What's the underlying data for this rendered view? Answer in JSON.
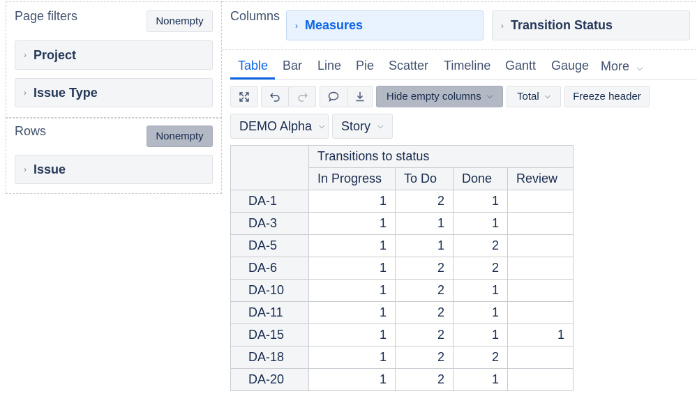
{
  "left_panel": {
    "page_filters": {
      "title": "Page filters",
      "nonempty_label": "Nonempty",
      "items": [
        {
          "label": "Project"
        },
        {
          "label": "Issue Type"
        }
      ]
    },
    "rows": {
      "title": "Rows",
      "nonempty_label": "Nonempty",
      "items": [
        {
          "label": "Issue"
        }
      ]
    }
  },
  "columns_panel": {
    "title": "Columns",
    "items": [
      {
        "label": "Measures"
      },
      {
        "label": "Transition Status"
      }
    ]
  },
  "view_tabs": {
    "tabs": [
      {
        "label": "Table",
        "active": true
      },
      {
        "label": "Bar"
      },
      {
        "label": "Line"
      },
      {
        "label": "Pie"
      },
      {
        "label": "Scatter"
      },
      {
        "label": "Timeline"
      },
      {
        "label": "Gantt"
      },
      {
        "label": "Gauge"
      }
    ],
    "more_label": "More"
  },
  "toolbar": {
    "hide_empty_columns_label": "Hide empty columns",
    "total_label": "Total",
    "freeze_header_label": "Freeze header"
  },
  "filters": {
    "project_value": "DEMO Alpha",
    "issue_type_value": "Story"
  },
  "table": {
    "group_header": "Transitions to status",
    "columns": [
      "In Progress",
      "To Do",
      "Done",
      "Review"
    ],
    "rows": [
      {
        "issue": "DA-1",
        "values": [
          "1",
          "2",
          "1",
          ""
        ]
      },
      {
        "issue": "DA-3",
        "values": [
          "1",
          "1",
          "1",
          ""
        ]
      },
      {
        "issue": "DA-5",
        "values": [
          "1",
          "1",
          "2",
          ""
        ]
      },
      {
        "issue": "DA-6",
        "values": [
          "1",
          "2",
          "2",
          ""
        ]
      },
      {
        "issue": "DA-10",
        "values": [
          "1",
          "2",
          "1",
          ""
        ]
      },
      {
        "issue": "DA-11",
        "values": [
          "1",
          "2",
          "1",
          ""
        ]
      },
      {
        "issue": "DA-15",
        "values": [
          "1",
          "2",
          "1",
          "1"
        ]
      },
      {
        "issue": "DA-18",
        "values": [
          "1",
          "2",
          "2",
          ""
        ]
      },
      {
        "issue": "DA-20",
        "values": [
          "1",
          "2",
          "1",
          ""
        ]
      }
    ]
  },
  "colors": {
    "accent": "#0c66e4",
    "panel_bg": "#f4f5f7",
    "active_button": "#b3b9c4"
  }
}
